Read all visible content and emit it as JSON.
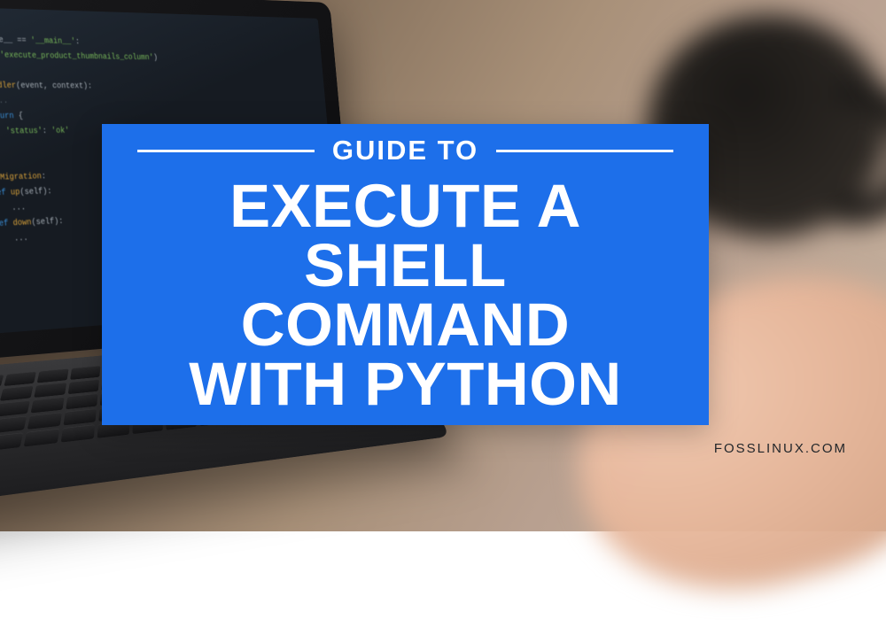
{
  "banner": {
    "kicker": "GUIDE TO",
    "line1": "EXECUTE A",
    "line2": "SHELL COMMAND",
    "line3": "WITH PYTHON"
  },
  "watermark": "FOSSLINUX.COM"
}
